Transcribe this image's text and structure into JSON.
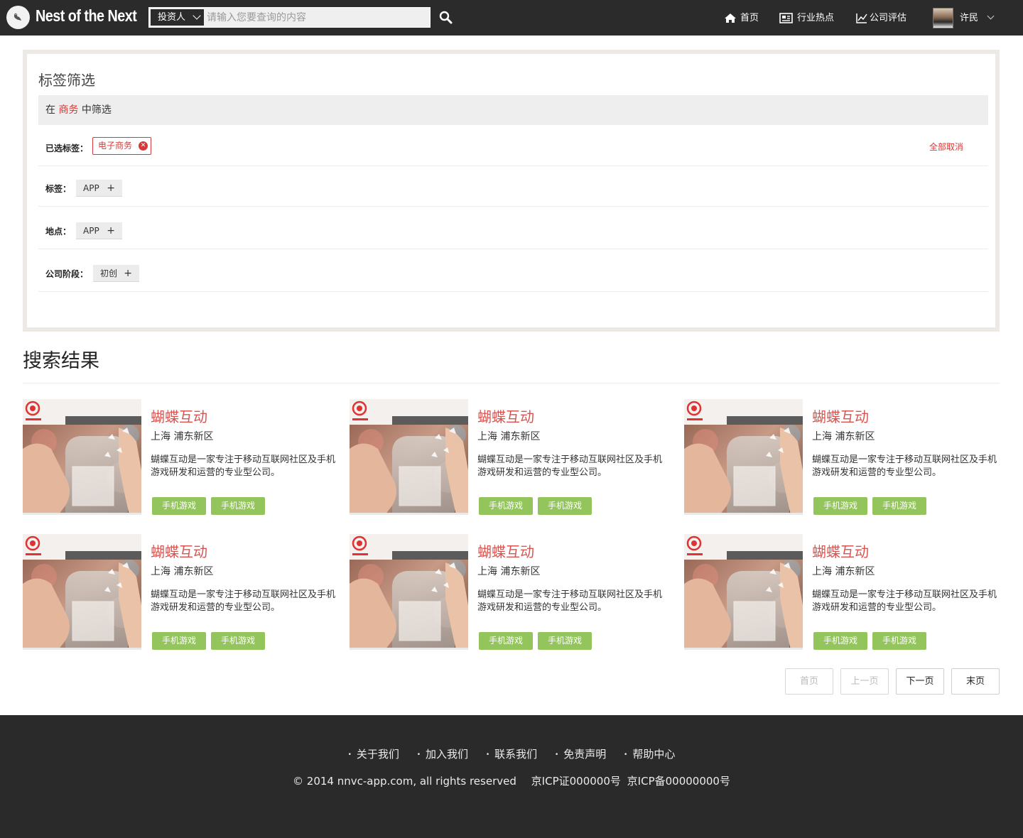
{
  "header": {
    "logo_text": "Nest of the Next",
    "search": {
      "type_selected": "投资人",
      "placeholder": "请输入您要查询的内容"
    },
    "nav": [
      {
        "label": "首页",
        "icon": "home-icon"
      },
      {
        "label": "行业热点",
        "icon": "news-icon"
      },
      {
        "label": "公司评估",
        "icon": "chart-icon"
      }
    ],
    "user_name": "许民"
  },
  "filter": {
    "title": "标签筛选",
    "scope_prefix": "在",
    "scope_keyword": "商务",
    "scope_suffix": "中筛选",
    "selected_label": "已选标签：",
    "selected_tags": [
      "电子商务"
    ],
    "cancel_all": "全部取消",
    "rows": [
      {
        "label": "标签：",
        "option": "APP"
      },
      {
        "label": "地点：",
        "option": "APP"
      },
      {
        "label": "公司阶段：",
        "option": "初创"
      }
    ]
  },
  "results": {
    "title": "搜索结果",
    "cards": [
      {
        "name": "蝴蝶互动",
        "location": "上海 浦东新区",
        "description": "蝴蝶互动是一家专注于移动互联网社区及手机游戏研发和运营的专业型公司。",
        "tags": [
          "手机游戏",
          "手机游戏"
        ]
      },
      {
        "name": "蝴蝶互动",
        "location": "上海 浦东新区",
        "description": "蝴蝶互动是一家专注于移动互联网社区及手机游戏研发和运营的专业型公司。",
        "tags": [
          "手机游戏",
          "手机游戏"
        ]
      },
      {
        "name": "蝴蝶互动",
        "location": "上海 浦东新区",
        "description": "蝴蝶互动是一家专注于移动互联网社区及手机游戏研发和运营的专业型公司。",
        "tags": [
          "手机游戏",
          "手机游戏"
        ]
      },
      {
        "name": "蝴蝶互动",
        "location": "上海 浦东新区",
        "description": "蝴蝶互动是一家专注于移动互联网社区及手机游戏研发和运营的专业型公司。",
        "tags": [
          "手机游戏",
          "手机游戏"
        ]
      },
      {
        "name": "蝴蝶互动",
        "location": "上海 浦东新区",
        "description": "蝴蝶互动是一家专注于移动互联网社区及手机游戏研发和运营的专业型公司。",
        "tags": [
          "手机游戏",
          "手机游戏"
        ]
      },
      {
        "name": "蝴蝶互动",
        "location": "上海 浦东新区",
        "description": "蝴蝶互动是一家专注于移动互联网社区及手机游戏研发和运营的专业型公司。",
        "tags": [
          "手机游戏",
          "手机游戏"
        ]
      }
    ]
  },
  "pagination": {
    "first": "首页",
    "prev": "上一页",
    "next": "下一页",
    "last": "末页"
  },
  "footer": {
    "links": [
      "关于我们",
      "加入我们",
      "联系我们",
      "免责声明",
      "帮助中心"
    ],
    "copyright": "© 2014 nnvc-app.com, all rights reserved",
    "icp1": "京ICP证000000号",
    "icp2": "京ICP备00000000号"
  },
  "colors": {
    "topbar": "#2b2b2b",
    "accent_red": "#e2322f",
    "card_title": "#d9534f",
    "tag_green": "#93c55c",
    "footer": "#2a2a2a"
  }
}
